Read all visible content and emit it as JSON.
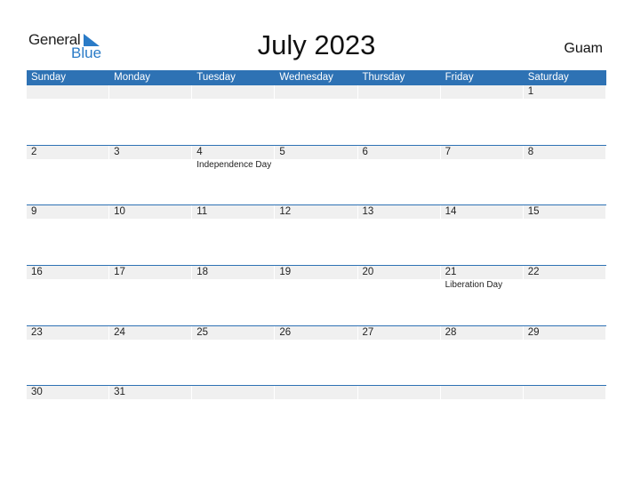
{
  "logo": {
    "line1": "General",
    "line2": "Blue"
  },
  "title": "July 2023",
  "country": "Guam",
  "colors": {
    "accent": "#2e72b4",
    "strip": "#f0f0f0"
  },
  "weekdays": [
    "Sunday",
    "Monday",
    "Tuesday",
    "Wednesday",
    "Thursday",
    "Friday",
    "Saturday"
  ],
  "weeks": [
    {
      "days": [
        "",
        "",
        "",
        "",
        "",
        "",
        "1"
      ],
      "events": [
        "",
        "",
        "",
        "",
        "",
        "",
        ""
      ]
    },
    {
      "days": [
        "2",
        "3",
        "4",
        "5",
        "6",
        "7",
        "8"
      ],
      "events": [
        "",
        "",
        "Independence Day",
        "",
        "",
        "",
        ""
      ]
    },
    {
      "days": [
        "9",
        "10",
        "11",
        "12",
        "13",
        "14",
        "15"
      ],
      "events": [
        "",
        "",
        "",
        "",
        "",
        "",
        ""
      ]
    },
    {
      "days": [
        "16",
        "17",
        "18",
        "19",
        "20",
        "21",
        "22"
      ],
      "events": [
        "",
        "",
        "",
        "",
        "",
        "Liberation Day",
        ""
      ]
    },
    {
      "days": [
        "23",
        "24",
        "25",
        "26",
        "27",
        "28",
        "29"
      ],
      "events": [
        "",
        "",
        "",
        "",
        "",
        "",
        ""
      ]
    },
    {
      "days": [
        "30",
        "31",
        "",
        "",
        "",
        "",
        ""
      ],
      "events": [
        "",
        "",
        "",
        "",
        "",
        "",
        ""
      ]
    }
  ]
}
